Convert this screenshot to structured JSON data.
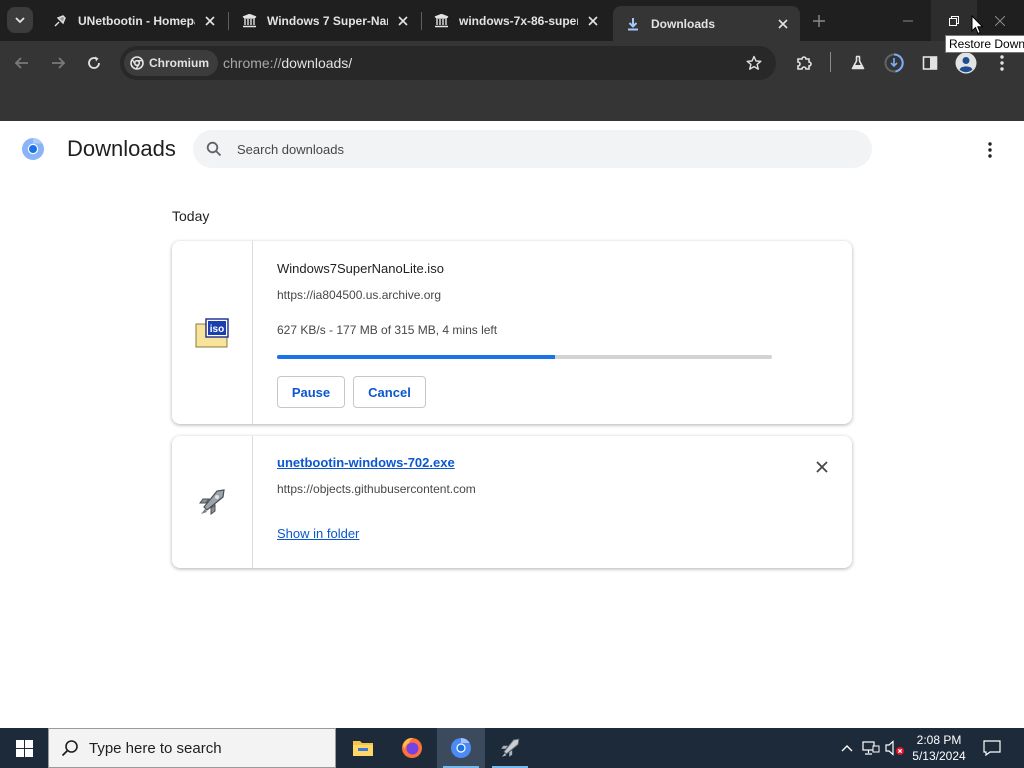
{
  "browser": {
    "tabs": [
      {
        "title": "UNetbootin - Homepa",
        "favicon": "rocket-icon",
        "active": false
      },
      {
        "title": "Windows 7 Super-Nan",
        "favicon": "archive-icon",
        "active": false
      },
      {
        "title": "windows-7x-86-super",
        "favicon": "archive-icon",
        "active": false
      },
      {
        "title": "Downloads",
        "favicon": "download-icon",
        "active": true
      }
    ],
    "tooltip": "Restore Down",
    "omnibox": {
      "chip_label": "Chromium",
      "url_scheme": "chrome://",
      "url_host": "downloads",
      "url_path": "/"
    }
  },
  "page": {
    "title": "Downloads",
    "search_placeholder": "Search downloads",
    "section_label": "Today",
    "downloads": [
      {
        "filename": "Windows7SuperNanoLite.iso",
        "source": "https://ia804500.us.archive.org",
        "status": "627 KB/s - 177 MB of 315 MB, 4 mins left",
        "progress_fraction": 0.5619,
        "buttons": {
          "pause": "Pause",
          "cancel": "Cancel"
        },
        "icon": "iso-file-icon"
      },
      {
        "filename": "unetbootin-windows-702.exe",
        "source": "https://objects.githubusercontent.com",
        "action": "Show in folder",
        "icon": "unetbootin-icon"
      }
    ]
  },
  "taskbar": {
    "search_placeholder": "Type here to search",
    "time": "2:08 PM",
    "date": "5/13/2024"
  },
  "colors": {
    "accent": "#0b57d0",
    "progress": "#1a73e8",
    "tabstrip": "#1f1f1f",
    "toolbar": "#353535",
    "taskbar": "#1c2a3a"
  }
}
